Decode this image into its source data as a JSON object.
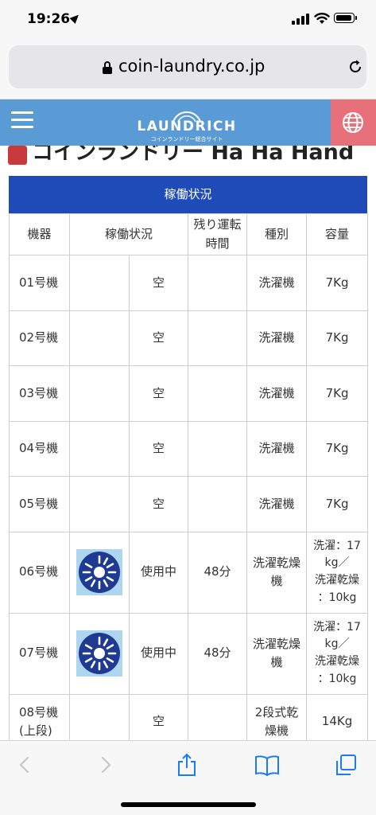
{
  "status_bar": {
    "time": "19:26"
  },
  "browser": {
    "url": "coin-laundry.co.jp"
  },
  "site_header": {
    "logo_text": "LAUNDRICH",
    "logo_subtext": "コインランドリー総合サイト"
  },
  "shop": {
    "title": "コインランドリー Ha Ha Hand"
  },
  "status_table": {
    "caption": "稼働状況",
    "headers": {
      "machine": "機器",
      "status": "稼働状況",
      "remaining_line1": "残り運転",
      "remaining_line2": "時間",
      "type": "種別",
      "capacity": "容量"
    },
    "rows": [
      {
        "machine": "01号機",
        "status": "空",
        "remaining": "",
        "type": "洗濯機",
        "capacity": "7Kg"
      },
      {
        "machine": "02号機",
        "status": "空",
        "remaining": "",
        "type": "洗濯機",
        "capacity": "7Kg"
      },
      {
        "machine": "03号機",
        "status": "空",
        "remaining": "",
        "type": "洗濯機",
        "capacity": "7Kg"
      },
      {
        "machine": "04号機",
        "status": "空",
        "remaining": "",
        "type": "洗濯機",
        "capacity": "7Kg"
      },
      {
        "machine": "05号機",
        "status": "空",
        "remaining": "",
        "type": "洗濯機",
        "capacity": "7Kg"
      },
      {
        "machine": "06号機",
        "status": "使用中",
        "remaining": "48分",
        "type_line1": "洗濯乾燥",
        "type_line2": "機",
        "capacity_line1": "洗濯：17",
        "capacity_line2": "kg／",
        "capacity_line3": "洗濯乾燥",
        "capacity_line4": "：10kg"
      },
      {
        "machine": "07号機",
        "status": "使用中",
        "remaining": "48分",
        "type_line1": "洗濯乾燥",
        "type_line2": "機",
        "capacity_line1": "洗濯：17",
        "capacity_line2": "kg／",
        "capacity_line3": "洗濯乾燥",
        "capacity_line4": "：10kg"
      },
      {
        "machine_line1": "08号機",
        "machine_line2": "(上段)",
        "status": "空",
        "remaining": "",
        "type_line1": "2段式乾",
        "type_line2": "燥機",
        "capacity": "14Kg"
      }
    ]
  },
  "colors": {
    "header_bg": "#5b9bd5",
    "globe_btn_bg": "#e8707a",
    "caption_bg": "#1e4bb8",
    "toolbar_icon": "#1a7cf5"
  }
}
